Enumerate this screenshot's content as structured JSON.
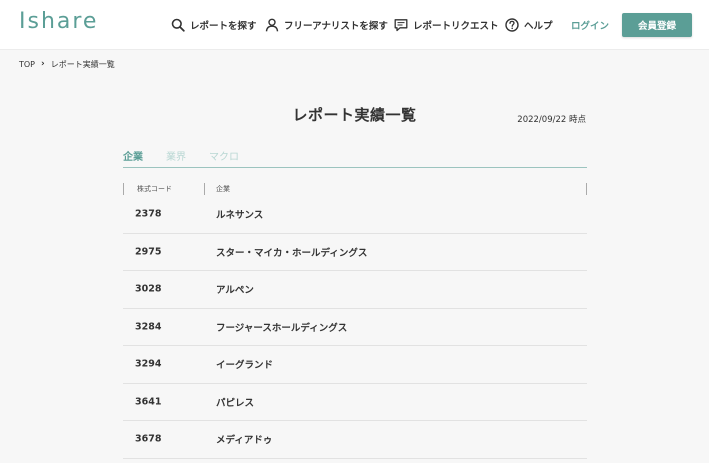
{
  "header": {
    "logo": "Ishare",
    "nav": {
      "search": "レポートを探す",
      "analyst": "フリーアナリストを探す",
      "request": "レポートリクエスト",
      "help": "ヘルプ",
      "login": "ログイン"
    },
    "signup": "会員登録"
  },
  "breadcrumb": {
    "top": "TOP",
    "current": "レポート実績一覧"
  },
  "page": {
    "title": "レポート実績一覧",
    "date": "2022/09/22 時点"
  },
  "tabs": [
    {
      "label": "企業",
      "active": true
    },
    {
      "label": "業界",
      "active": false
    },
    {
      "label": "マクロ",
      "active": false
    }
  ],
  "table": {
    "headers": {
      "code": "株式コード",
      "name": "企業"
    },
    "rows": [
      {
        "code": "2378",
        "name": "ルネサンス"
      },
      {
        "code": "2975",
        "name": "スター・マイカ・ホールディングス"
      },
      {
        "code": "3028",
        "name": "アルペン"
      },
      {
        "code": "3284",
        "name": "フージャースホールディングス"
      },
      {
        "code": "3294",
        "name": "イーグランド"
      },
      {
        "code": "3641",
        "name": "パピレス"
      },
      {
        "code": "3678",
        "name": "メディアドゥ"
      }
    ]
  },
  "colors": {
    "accent": "#5b9e96",
    "background": "#f7f7f7"
  }
}
